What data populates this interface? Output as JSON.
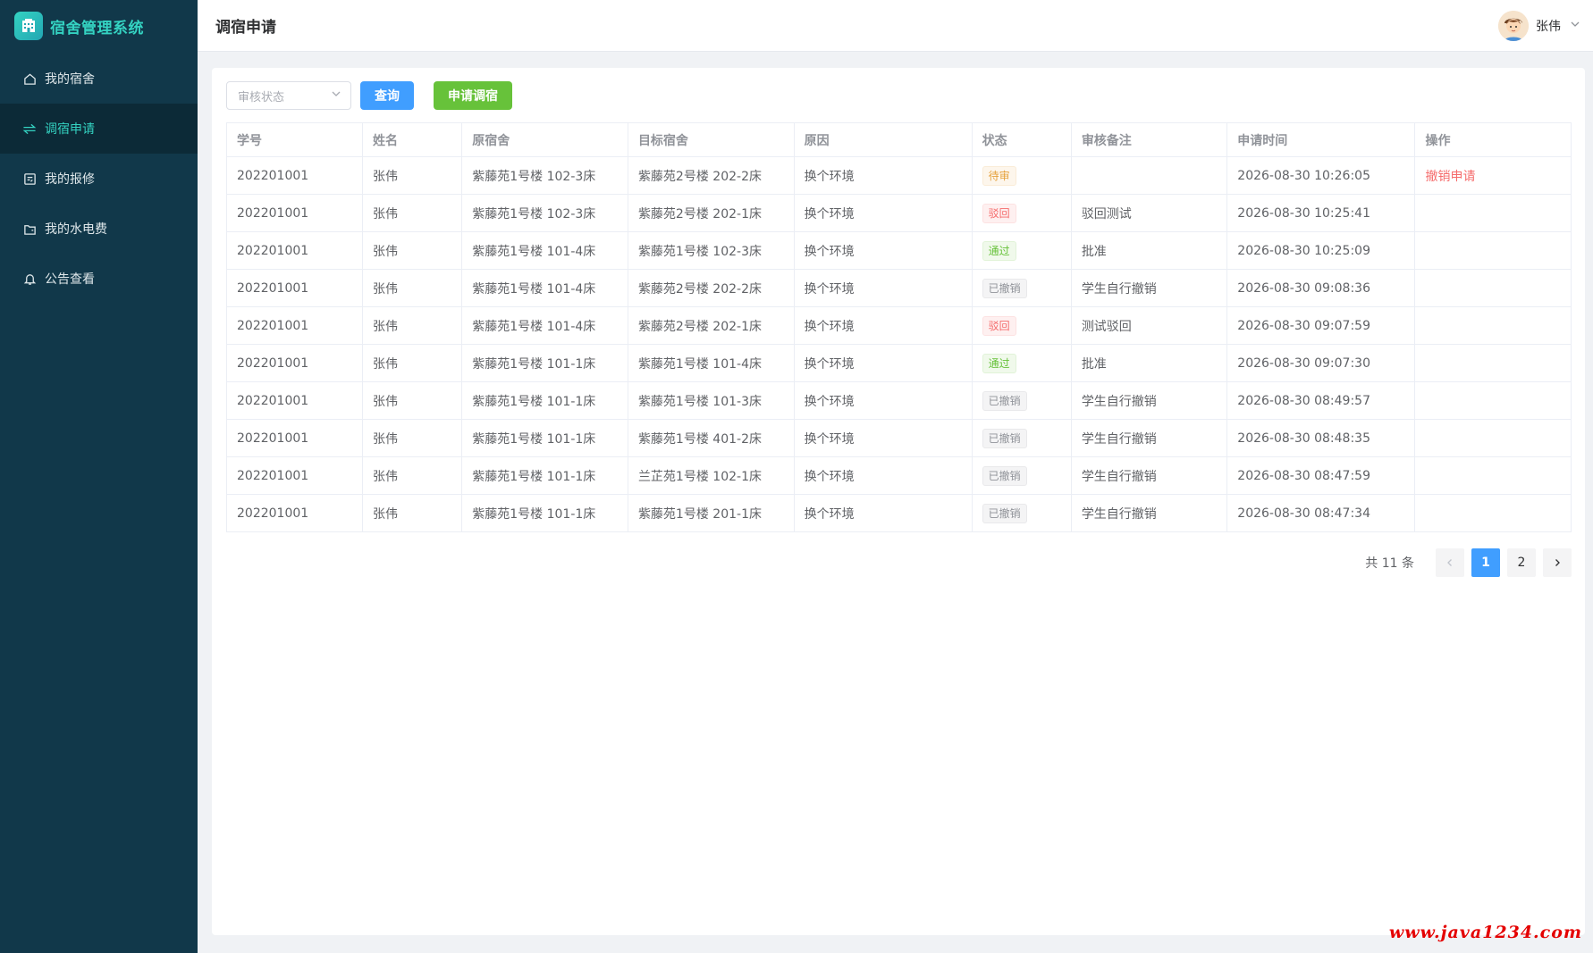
{
  "app": {
    "title": "宿舍管理系统"
  },
  "sidebar": {
    "items": [
      {
        "label": "我的宿舍",
        "icon": "home-icon",
        "active": false
      },
      {
        "label": "调宿申请",
        "icon": "swap-icon",
        "active": true
      },
      {
        "label": "我的报修",
        "icon": "repair-icon",
        "active": false
      },
      {
        "label": "我的水电费",
        "icon": "wallet-icon",
        "active": false
      },
      {
        "label": "公告查看",
        "icon": "bell-icon",
        "active": false
      }
    ]
  },
  "header": {
    "title": "调宿申请",
    "user_name": "张伟"
  },
  "toolbar": {
    "status_placeholder": "审核状态",
    "query_label": "查询",
    "apply_label": "申请调宿"
  },
  "table": {
    "columns": [
      "学号",
      "姓名",
      "原宿舍",
      "目标宿舍",
      "原因",
      "状态",
      "审核备注",
      "申请时间",
      "操作"
    ],
    "rows": [
      {
        "student_id": "202201001",
        "name": "张伟",
        "from": "紫藤苑1号楼 102-3床",
        "to": "紫藤苑2号楼 202-2床",
        "reason": "换个环境",
        "status": "待审",
        "status_type": "pending",
        "remark": "",
        "time": "2026-08-30 10:26:05",
        "action": "撤销申请"
      },
      {
        "student_id": "202201001",
        "name": "张伟",
        "from": "紫藤苑1号楼 102-3床",
        "to": "紫藤苑2号楼 202-1床",
        "reason": "换个环境",
        "status": "驳回",
        "status_type": "rejected",
        "remark": "驳回测试",
        "time": "2026-08-30 10:25:41",
        "action": ""
      },
      {
        "student_id": "202201001",
        "name": "张伟",
        "from": "紫藤苑1号楼 101-4床",
        "to": "紫藤苑1号楼 102-3床",
        "reason": "换个环境",
        "status": "通过",
        "status_type": "approved",
        "remark": "批准",
        "time": "2026-08-30 10:25:09",
        "action": ""
      },
      {
        "student_id": "202201001",
        "name": "张伟",
        "from": "紫藤苑1号楼 101-4床",
        "to": "紫藤苑2号楼 202-2床",
        "reason": "换个环境",
        "status": "已撤销",
        "status_type": "cancelled",
        "remark": "学生自行撤销",
        "time": "2026-08-30 09:08:36",
        "action": ""
      },
      {
        "student_id": "202201001",
        "name": "张伟",
        "from": "紫藤苑1号楼 101-4床",
        "to": "紫藤苑2号楼 202-1床",
        "reason": "换个环境",
        "status": "驳回",
        "status_type": "rejected",
        "remark": "测试驳回",
        "time": "2026-08-30 09:07:59",
        "action": ""
      },
      {
        "student_id": "202201001",
        "name": "张伟",
        "from": "紫藤苑1号楼 101-1床",
        "to": "紫藤苑1号楼 101-4床",
        "reason": "换个环境",
        "status": "通过",
        "status_type": "approved",
        "remark": "批准",
        "time": "2026-08-30 09:07:30",
        "action": ""
      },
      {
        "student_id": "202201001",
        "name": "张伟",
        "from": "紫藤苑1号楼 101-1床",
        "to": "紫藤苑1号楼 101-3床",
        "reason": "换个环境",
        "status": "已撤销",
        "status_type": "cancelled",
        "remark": "学生自行撤销",
        "time": "2026-08-30 08:49:57",
        "action": ""
      },
      {
        "student_id": "202201001",
        "name": "张伟",
        "from": "紫藤苑1号楼 101-1床",
        "to": "紫藤苑1号楼 401-2床",
        "reason": "换个环境",
        "status": "已撤销",
        "status_type": "cancelled",
        "remark": "学生自行撤销",
        "time": "2026-08-30 08:48:35",
        "action": ""
      },
      {
        "student_id": "202201001",
        "name": "张伟",
        "from": "紫藤苑1号楼 101-1床",
        "to": "兰芷苑1号楼 102-1床",
        "reason": "换个环境",
        "status": "已撤销",
        "status_type": "cancelled",
        "remark": "学生自行撤销",
        "time": "2026-08-30 08:47:59",
        "action": ""
      },
      {
        "student_id": "202201001",
        "name": "张伟",
        "from": "紫藤苑1号楼 101-1床",
        "to": "紫藤苑1号楼 201-1床",
        "reason": "换个环境",
        "status": "已撤销",
        "status_type": "cancelled",
        "remark": "学生自行撤销",
        "time": "2026-08-30 08:47:34",
        "action": ""
      }
    ]
  },
  "pagination": {
    "total_text": "共 11 条",
    "pages": [
      "1",
      "2"
    ],
    "current": "1"
  },
  "watermark": "www.java1234.com",
  "colors": {
    "sidebar": "#11384a",
    "accent": "#34d3c2",
    "primary": "#409eff",
    "success": "#67c23a",
    "danger": "#f56c6c",
    "warning": "#e6a23c"
  }
}
